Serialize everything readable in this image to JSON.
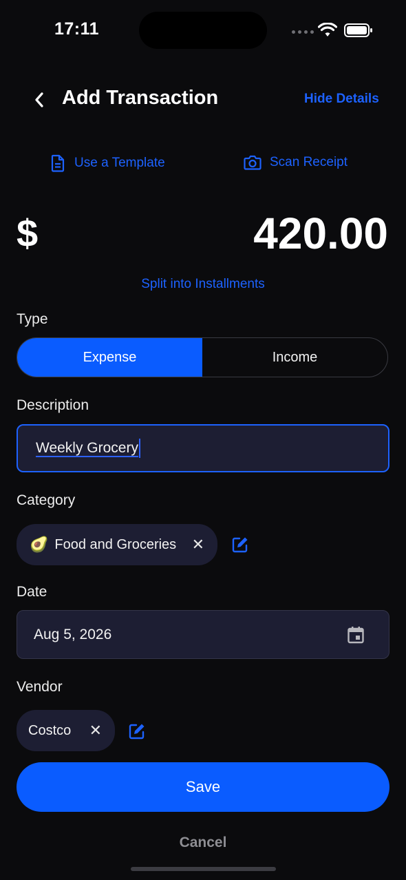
{
  "status_bar": {
    "time": "17:11"
  },
  "header": {
    "title": "Add Transaction",
    "hide_details": "Hide Details"
  },
  "actions": {
    "template": "Use a Template",
    "scan": "Scan Receipt"
  },
  "amount": {
    "currency": "$",
    "value": "420.00",
    "split": "Split into Installments"
  },
  "type": {
    "label": "Type",
    "options": [
      "Expense",
      "Income"
    ],
    "selected": "Expense"
  },
  "description": {
    "label": "Description",
    "value": "Weekly Grocery"
  },
  "category": {
    "label": "Category",
    "emoji": "🥑",
    "value": "Food and Groceries"
  },
  "date": {
    "label": "Date",
    "value": "Aug 5, 2026"
  },
  "vendor": {
    "label": "Vendor",
    "value": "Costco"
  },
  "buttons": {
    "save": "Save",
    "cancel": "Cancel"
  },
  "colors": {
    "accent": "#0a5cff",
    "link": "#1d62ff",
    "background": "#0b0b0d",
    "field": "#1d1e33"
  }
}
